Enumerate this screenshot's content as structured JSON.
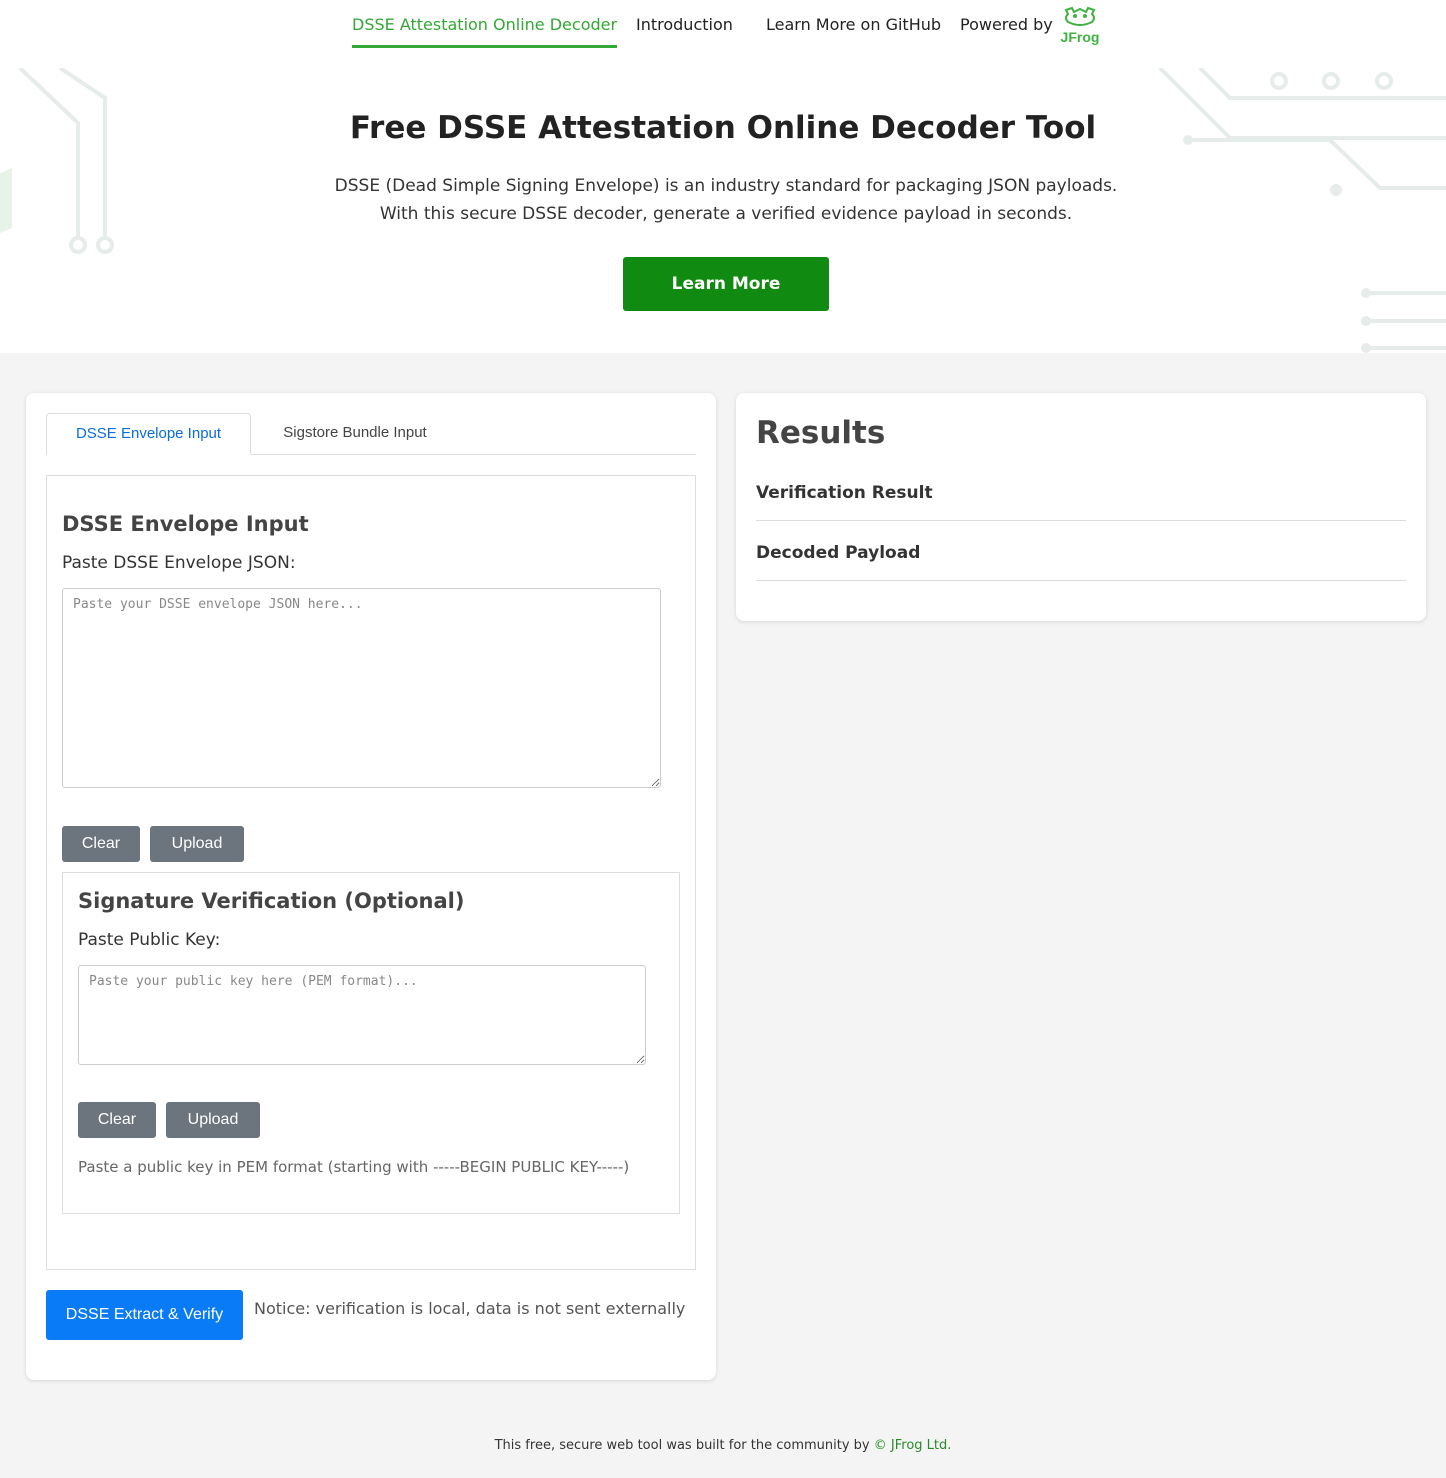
{
  "nav": {
    "items": [
      {
        "label": "DSSE Attestation Online Decoder",
        "active": true
      },
      {
        "label": "Introduction",
        "active": false
      },
      {
        "label": "Learn More on GitHub",
        "active": false
      }
    ],
    "powered_by": "Powered by",
    "logo_text": "JFrog",
    "logo_icon": "jfrog-logo-icon"
  },
  "hero": {
    "title": "Free DSSE Attestation Online Decoder Tool",
    "description": "DSSE (Dead Simple Signing Envelope) is an industry standard for packaging JSON payloads. With this secure DSSE decoder, generate a verified evidence payload in seconds.",
    "cta_label": "Learn More"
  },
  "input": {
    "tabs": [
      {
        "label": "DSSE Envelope Input",
        "active": true
      },
      {
        "label": "Sigstore Bundle Input",
        "active": false
      }
    ],
    "envelope": {
      "title": "DSSE Envelope Input",
      "label": "Paste DSSE Envelope JSON:",
      "placeholder": "Paste your DSSE envelope JSON here...",
      "value": "",
      "clear_label": "Clear",
      "upload_label": "Upload"
    },
    "signature": {
      "title": "Signature Verification (Optional)",
      "label": "Paste Public Key:",
      "placeholder": "Paste your public key here (PEM format)...",
      "value": "",
      "clear_label": "Clear",
      "upload_label": "Upload",
      "hint": "Paste a public key in PEM format (starting with -----BEGIN PUBLIC KEY-----)"
    },
    "verify_label": "DSSE Extract & Verify",
    "notice": "Notice: verification is local, data is not sent externally"
  },
  "results": {
    "title": "Results",
    "rows": [
      {
        "label": "Verification Result"
      },
      {
        "label": "Decoded Payload"
      }
    ]
  },
  "footer": {
    "text": "This free, secure web tool was built for the community by ",
    "link_label": "© JFrog Ltd."
  },
  "colors": {
    "accent_green": "#34a834",
    "cta_green": "#118a11",
    "primary_blue": "#0a7bf7",
    "tab_blue": "#0a6de0",
    "gray_button": "#6c757d"
  }
}
